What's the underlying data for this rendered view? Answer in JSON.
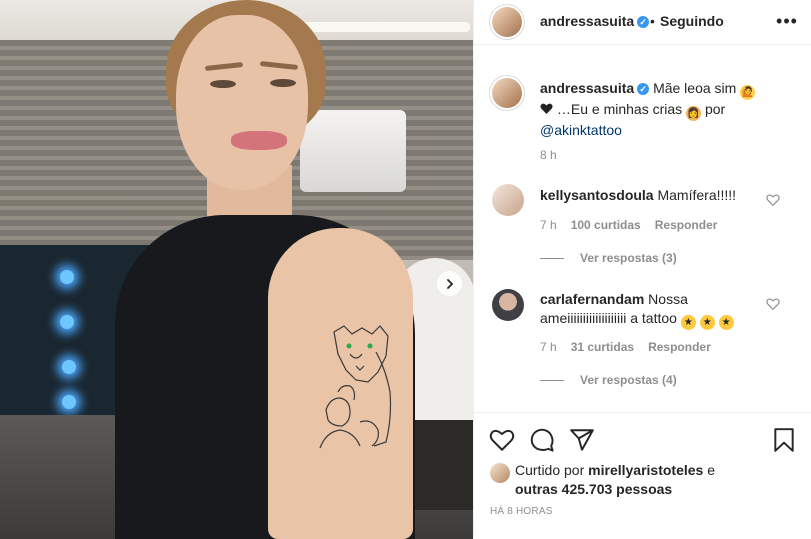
{
  "colors": {
    "accent": "#3897f0",
    "link": "#00376b",
    "muted": "#8e8e8e",
    "text": "#262626",
    "border": "#efefef"
  },
  "header": {
    "username": "andressasuita",
    "dot": "•",
    "follow_status": "Seguindo",
    "more_icon": "more-horizontal-icon"
  },
  "caption": {
    "username": "andressasuita",
    "text_1": "Mãe leoa sim",
    "text_2": "…Eu e minhas crias",
    "text_3": "por",
    "mention": "@akinktattoo",
    "time": "8 h"
  },
  "comments": [
    {
      "username": "kellysantosdoula",
      "text_1": "Mamífera!!!!!",
      "text_2": "",
      "time": "7 h",
      "likes": "100 curtidas",
      "reply_label": "Responder",
      "view_replies": "Ver respostas (3)"
    },
    {
      "username": "carlafernandam",
      "text_1": "Nossa",
      "text_2": "ameiiiiiiiiiiiiiiiiiii a tattoo",
      "time": "7 h",
      "likes": "31 curtidas",
      "reply_label": "Responder",
      "view_replies": "Ver respostas (4)"
    }
  ],
  "likes": {
    "prefix": "Curtido por",
    "user": "mirellyaristoteles",
    "middle": "e",
    "others_label": "outras 425.703 pessoas"
  },
  "timestamp": "HÁ 8 HORAS",
  "icons": [
    "heart-icon",
    "comment-icon",
    "share-icon",
    "bookmark-icon",
    "chevron-right-icon",
    "verified-badge-icon"
  ]
}
